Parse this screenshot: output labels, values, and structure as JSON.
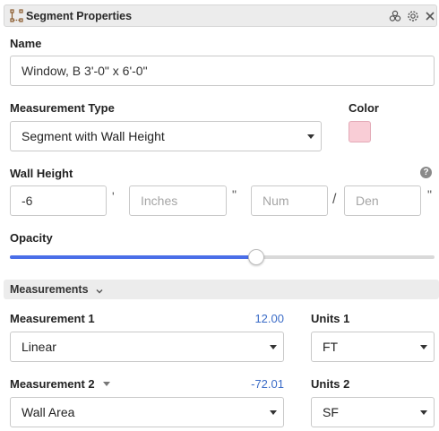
{
  "header": {
    "title": "Segment Properties"
  },
  "name": {
    "label": "Name",
    "value": "Window, B 3'-0\" x 6'-0\""
  },
  "measurement_type": {
    "label": "Measurement Type",
    "value": "Segment with Wall Height"
  },
  "color": {
    "label": "Color",
    "swatch": "#f9cdd6"
  },
  "wall_height": {
    "label": "Wall Height",
    "help": "?",
    "feet_value": "-6",
    "feet_mark": "'",
    "inches_placeholder": "Inches",
    "inches_mark": "\"",
    "num_placeholder": "Num",
    "slash": "/",
    "den_placeholder": "Den",
    "den_mark": "\""
  },
  "opacity": {
    "label": "Opacity",
    "level_percent": 58
  },
  "measurements": {
    "section_title": "Measurements",
    "m1": {
      "label": "Measurement 1",
      "value": "12.00",
      "type": "Linear",
      "units_label": "Units 1",
      "units": "FT"
    },
    "m2": {
      "label": "Measurement 2",
      "value": "-72.01",
      "type": "Wall Area",
      "units_label": "Units 2",
      "units": "SF"
    }
  },
  "colors": {
    "accent": "#4a6ee8",
    "value_blue": "#3b6cc7"
  }
}
